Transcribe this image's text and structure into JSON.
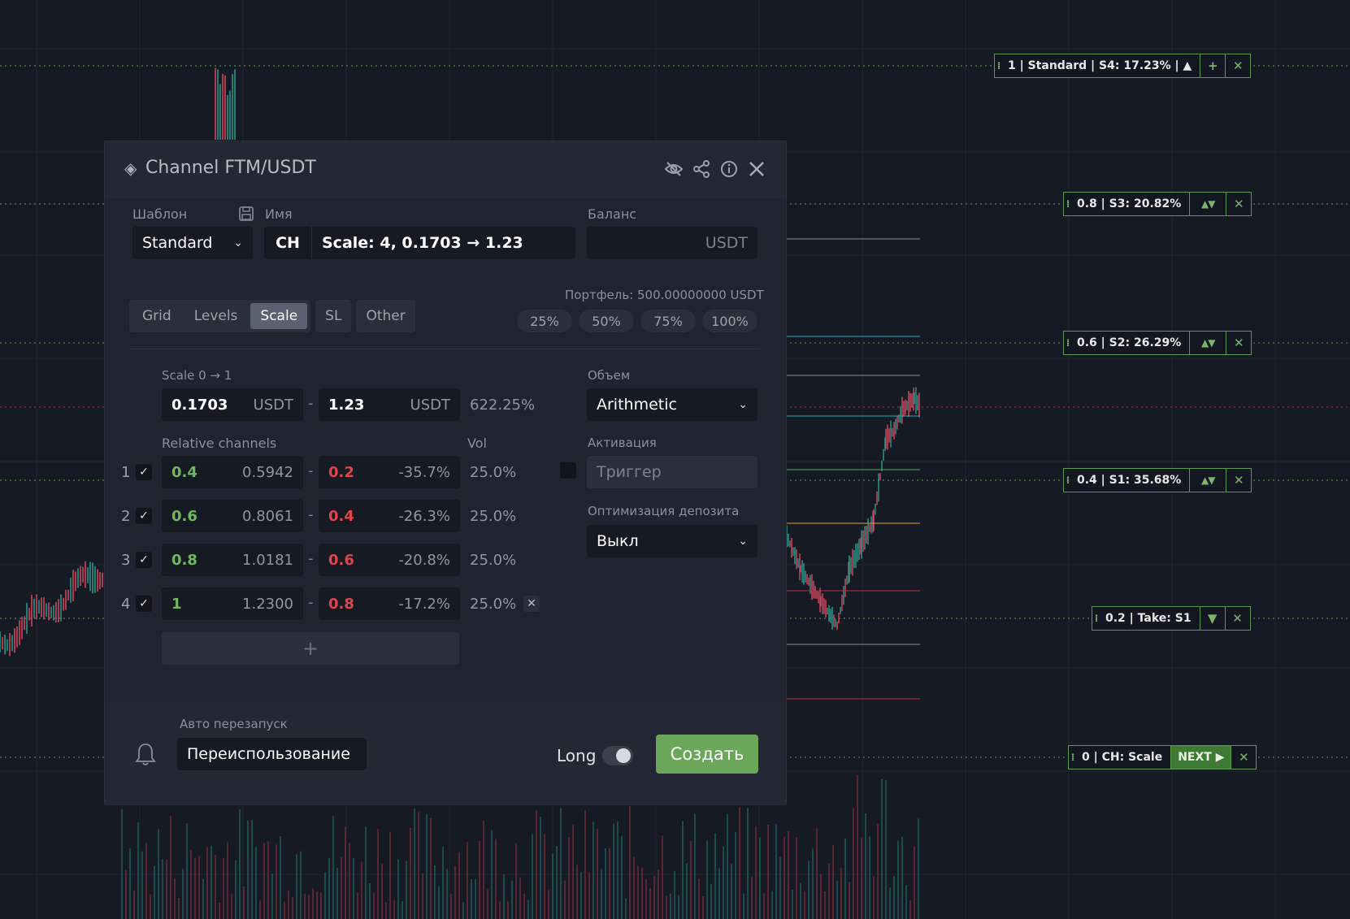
{
  "order_labels": [
    {
      "text": "1 | Standard | S4: 17.23% | ▲",
      "buttons": [
        "+",
        "✕"
      ]
    },
    {
      "text": "0.8 | S3: 20.82%",
      "buttons": [
        "▲▼",
        "✕"
      ]
    },
    {
      "text": "0.6 | S2: 26.29%",
      "buttons": [
        "▲▼",
        "✕"
      ]
    },
    {
      "text": "0.4 | S1: 35.68%",
      "buttons": [
        "▲▼",
        "✕"
      ]
    },
    {
      "text": "0.2 | Take: S1",
      "buttons": [
        "▼",
        "✕"
      ]
    },
    {
      "text": "0 | CH: Scale",
      "next": "NEXT ▶",
      "buttons": [
        "✕"
      ]
    }
  ],
  "dialog": {
    "title": "Channel FTM/USDT",
    "template_label": "Шаблон",
    "template_value": "Standard",
    "name_label": "Имя",
    "name_prefix": "CH",
    "name_value": "Scale: 4, 0.1703 → 1.23",
    "balance_label": "Баланс",
    "balance_unit": "USDT",
    "portfolio": "Портфель: 500.00000000  USDT",
    "tabs": [
      "Grid",
      "Levels",
      "Scale"
    ],
    "active_tab": "Scale",
    "extra_tabs": [
      "SL",
      "Other"
    ],
    "percent_buttons": [
      "25%",
      "50%",
      "75%",
      "100%"
    ],
    "scale_label": "Scale 0 → 1",
    "scale_from": "0.1703",
    "scale_to": "1.23",
    "scale_unit": "USDT",
    "scale_pct": "622.25%",
    "relative_label": "Relative channels",
    "vol_label": "Vol",
    "rows": [
      {
        "n": "1",
        "a": "0.4",
        "a_price": "0.5942",
        "b": "0.2",
        "b_pct": "-35.7%",
        "vol": "25.0%"
      },
      {
        "n": "2",
        "a": "0.6",
        "a_price": "0.8061",
        "b": "0.4",
        "b_pct": "-26.3%",
        "vol": "25.0%"
      },
      {
        "n": "3",
        "a": "0.8",
        "a_price": "1.0181",
        "b": "0.6",
        "b_pct": "-20.8%",
        "vol": "25.0%"
      },
      {
        "n": "4",
        "a": "1",
        "a_price": "1.2300",
        "b": "0.8",
        "b_pct": "-17.2%",
        "vol": "25.0%"
      }
    ],
    "add_row": "+",
    "volume_label": "Объем",
    "volume_value": "Arithmetic",
    "activation_label": "Активация",
    "activation_placeholder": "Триггер",
    "deposit_label": "Оптимизация депозита",
    "deposit_value": "Выкл",
    "auto_restart_label": "Авто перезапуск",
    "auto_restart_value": "Переиспользование",
    "long_label": "Long",
    "create_label": "Создать"
  }
}
